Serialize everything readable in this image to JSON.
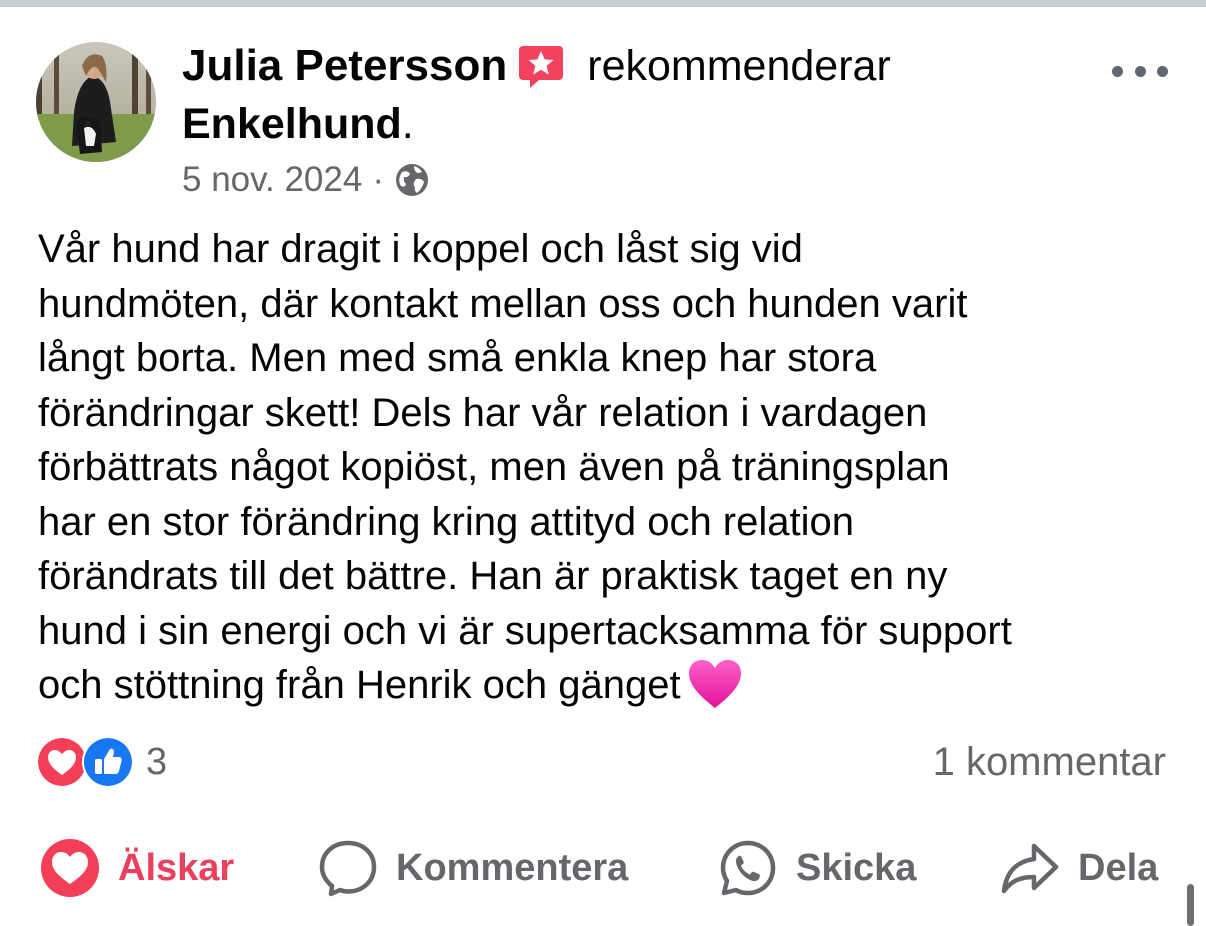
{
  "post": {
    "author": "Julia Petersson",
    "verb": "rekommenderar",
    "page": "Enkelhund",
    "page_suffix": ".",
    "date": "5 nov. 2024",
    "meta_separator": "·",
    "audience_icon": "globe-icon",
    "recommend_icon": "recommend-star-icon",
    "more_icon": "more-options-icon",
    "body_lines": [
      "Vår hund har dragit i koppel och låst sig vid",
      "hundmöten, där kontakt mellan oss och hunden varit",
      "långt borta. Men med små enkla knep har stora",
      "förändringar skett! Dels har vår relation i vardagen",
      "förbättrats något kopiöst, men även på träningsplan",
      "har en stor förändring kring attityd och relation",
      "förändrats till det bättre. Han är praktisk taget en ny",
      "hund i sin energi och vi är supertacksamma för support",
      "och stöttning från Henrik och gänget"
    ],
    "trailing_emoji": "pink-heart-icon"
  },
  "reactions": {
    "types": [
      "love",
      "like"
    ],
    "count": "3",
    "comments": "1 kommentar"
  },
  "actions": [
    {
      "label": "Älskar",
      "icon": "heart-icon"
    },
    {
      "label": "Kommentera",
      "icon": "comment-icon"
    },
    {
      "label": "Skicka",
      "icon": "whatsapp-icon"
    },
    {
      "label": "Dela",
      "icon": "share-icon"
    }
  ],
  "colors": {
    "love": "#f33e58",
    "like": "#1877f2",
    "secondary_text": "#65676b",
    "love_label": "#e9405d",
    "recommend_badge": "#f3425f"
  }
}
